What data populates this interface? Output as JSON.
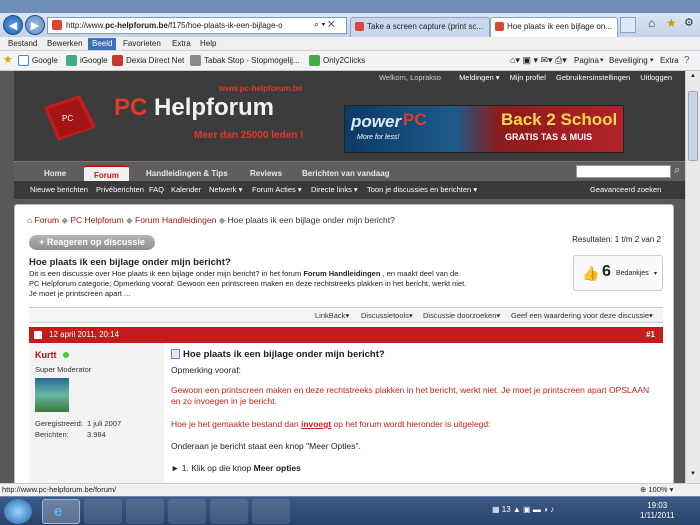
{
  "browser": {
    "url_domain": "pc-helpforum.be",
    "url_prefix": "http://www.",
    "url_suffix": "/f175/hoe-plaats-ik-een-bijlage-o",
    "tabs": [
      "Take a screen capture (print sc...",
      "Hoe plaats ik een bijlage on..."
    ],
    "menu": [
      "Bestand",
      "Bewerken",
      "Beeld",
      "Favorieten",
      "Extra",
      "Help"
    ],
    "favorites": [
      "Google",
      "iGoogle",
      "Dexia Direct Net",
      "Tabak Stop - Stopmogelij...",
      "Only2Clicks"
    ],
    "command_bar": [
      "Pagina",
      "Beveiliging",
      "Extra"
    ]
  },
  "header": {
    "toplinks": [
      "Welkom, Loprakso",
      "Meldingen",
      "Mijn profiel",
      "Gebruikersinstellingen",
      "Uitloggen"
    ],
    "logo_url": "www.pc-helpforum.be",
    "logo_pc": "PC",
    "logo_name": " Helpforum",
    "logo_sub": "Meer dan 25000 leden !",
    "banner_left": "power",
    "banner_left2": "PC",
    "banner_left3": "More for less!",
    "banner_right": "Back 2 School",
    "banner_right2": "GRATIS TAS & MUIS"
  },
  "nav": {
    "tabs": [
      "Home",
      "Forum",
      "Handleidingen & Tips",
      "Reviews",
      "Berichten van vandaag"
    ],
    "sub": [
      "Nieuwe berichten",
      "Privéberichten",
      "FAQ",
      "Kalender",
      "Netwerk",
      "Forum Acties",
      "Directe links",
      "Toon je discussies en berichten"
    ],
    "advanced": "Geavanceerd zoeken"
  },
  "breadcrumb": [
    "Forum",
    "PC Helpforum",
    "Forum Handleidingen",
    "Hoe plaats ik een bijlage onder mijn bericht?"
  ],
  "thread": {
    "reply_label": "+ Reageren op discussie",
    "results": "Resultaten: 1 t/m 2 van 2",
    "title": "Hoe plaats ik een bijlage onder mijn bericht?",
    "desc_1": "Dit is een discussie over Hoe plaats ik een bijlage onder mijn bericht? in het forum ",
    "desc_forum": "Forum Handleidingen",
    "desc_2": " , en maakt deel van de PC Helpforum categorie; Opmerking vooraf: Gewoon een printscreen maken en deze rechtstreeks plakken in het bericht, werkt niet. Je moet je printscreen apart ...",
    "thanks_count": "6",
    "thanks_label": "Bedankjes",
    "tools": [
      "LinkBack",
      "Discussietools",
      "Discussie doorzoeken",
      "Geef een waardering voor deze discussie"
    ]
  },
  "post": {
    "date": "12 april 2011, 20:14",
    "number": "#1",
    "username": "Kurtt",
    "role": "Super Moderator",
    "stats": [
      {
        "label": "Geregistreerd:",
        "value": "1 juli 2007"
      },
      {
        "label": "Berichten:",
        "value": "3.984"
      }
    ],
    "title": "Hoe plaats ik een bijlage onder mijn bericht?",
    "line1": "Opmerking vooraf:",
    "line2": "Gewoon een printscreen maken en deze rechtstreeks plakken in het bericht, werkt niet. Je moet je printscreen apart OPSLAAN en zo invoegen in je bericht.",
    "line3a": "Hoe je het gemaakte bestand dan ",
    "line3b": "invoegt",
    "line3c": " op het forum wordt hieronder is uitgelegd:",
    "line4": "Onderaan je bericht staat een knop \"Meer Opties\".",
    "line5a": "► 1. Klik op die knop ",
    "line5b": "Meer opties"
  },
  "status": {
    "url": "http://www.pc-helpforum.be/forum/",
    "zoom": "100%"
  },
  "clock": {
    "time": "19:03",
    "date": "1/11/2011"
  }
}
